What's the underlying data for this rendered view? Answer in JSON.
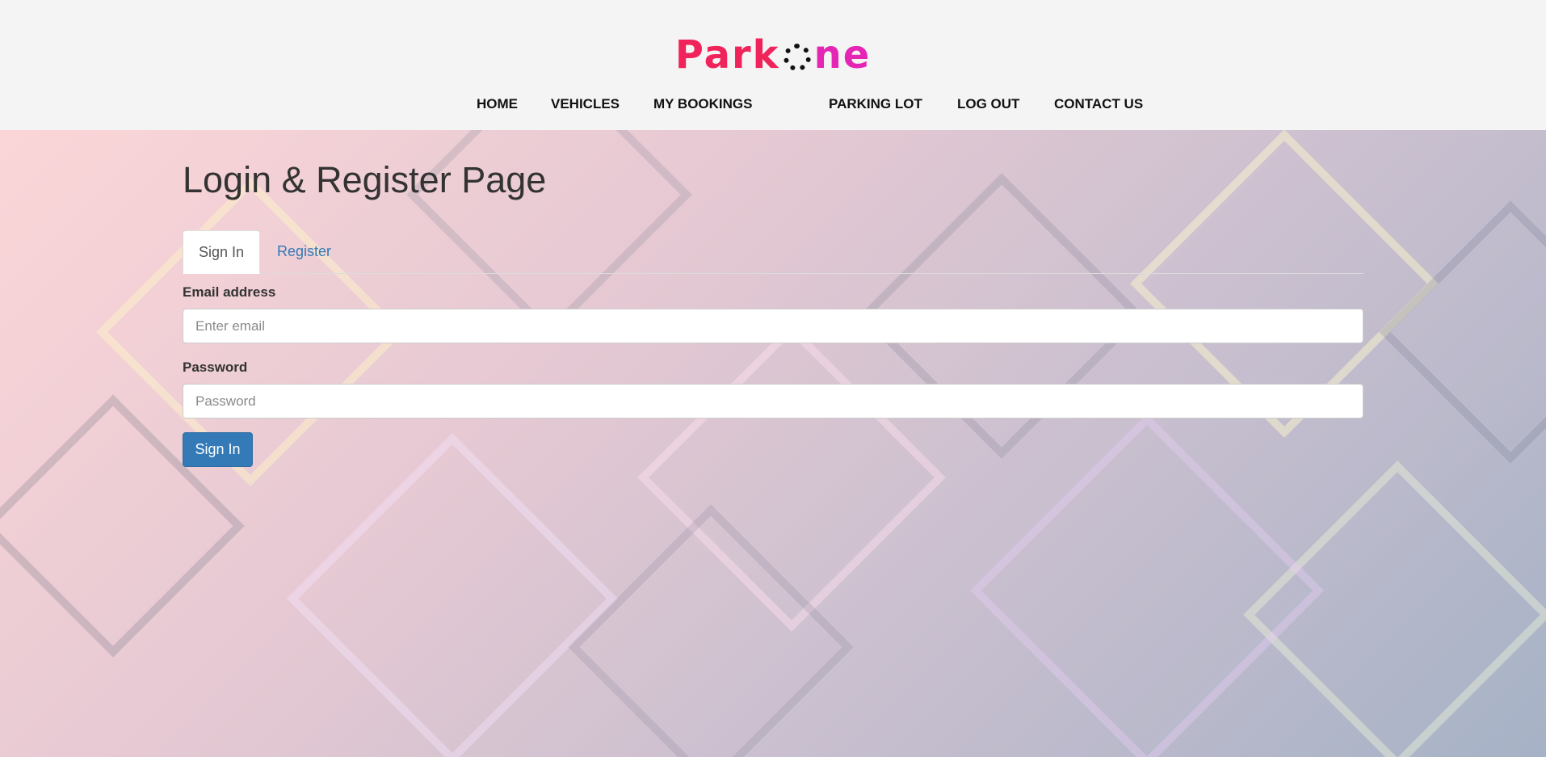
{
  "brand": {
    "logo_part1": "Park",
    "logo_part2": "ne",
    "logo_colors": [
      "#f0245a",
      "#e526b5"
    ]
  },
  "nav": {
    "items": [
      {
        "label": "HOME"
      },
      {
        "label": "VEHICLES"
      },
      {
        "label": "MY BOOKINGS"
      },
      {
        "label": "PARKING LOT"
      },
      {
        "label": "LOG OUT"
      },
      {
        "label": "CONTACT US"
      }
    ]
  },
  "main": {
    "title": "Login & Register Page",
    "tabs": [
      {
        "label": "Sign In",
        "active": true
      },
      {
        "label": "Register",
        "active": false
      }
    ],
    "form": {
      "email_label": "Email address",
      "email_placeholder": "Enter email",
      "email_value": "",
      "password_label": "Password",
      "password_placeholder": "Password",
      "password_value": "",
      "submit_label": "Sign In"
    }
  },
  "colors": {
    "header_bg": "#f4f4f4",
    "primary_button": "#337ab7",
    "link": "#337ab7"
  }
}
